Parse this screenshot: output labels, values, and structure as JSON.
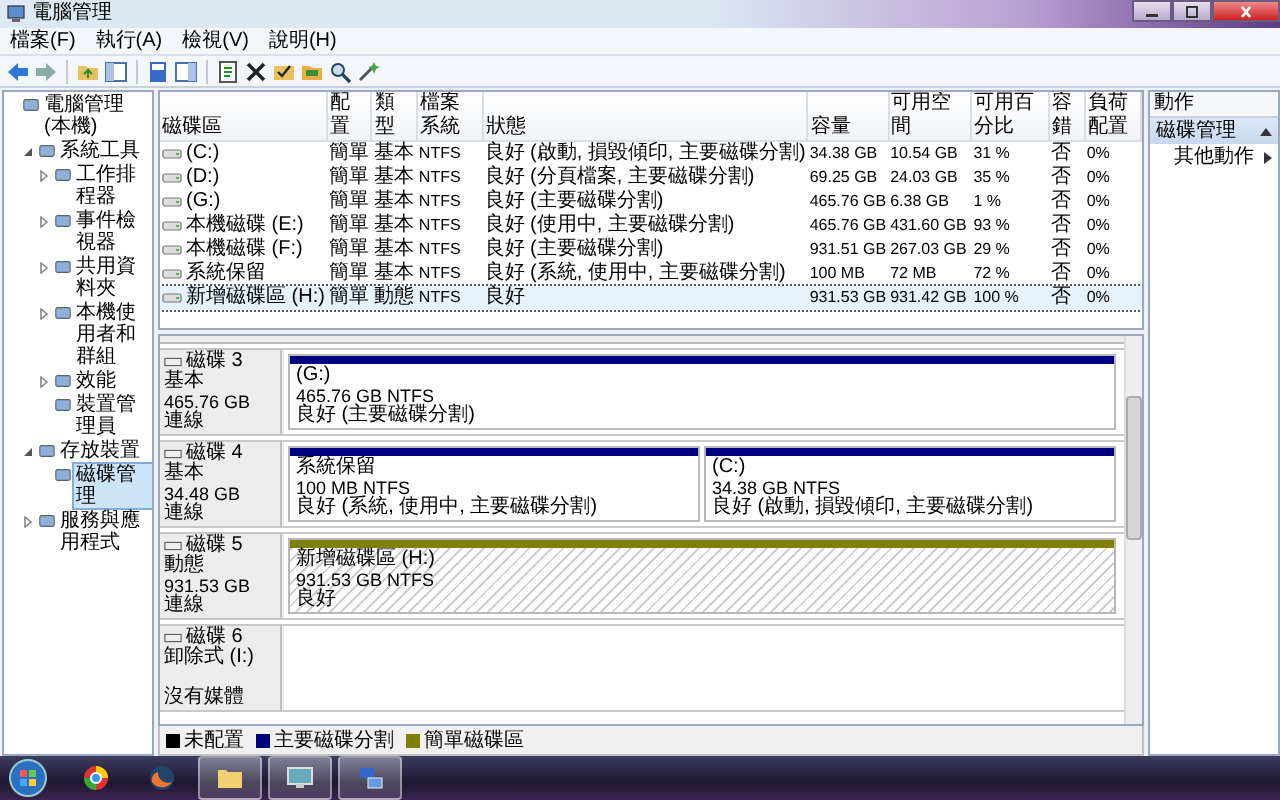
{
  "window": {
    "title": "電腦管理"
  },
  "menu": [
    "檔案(F)",
    "執行(A)",
    "檢視(V)",
    "說明(H)"
  ],
  "tree": [
    {
      "label": "電腦管理 (本機)",
      "selected": false,
      "children": [
        {
          "label": "系統工具",
          "expanded": true,
          "selected": false,
          "children": [
            {
              "label": "工作排程器",
              "expanded": false,
              "selected": false
            },
            {
              "label": "事件檢視器",
              "expanded": false,
              "selected": false
            },
            {
              "label": "共用資料夾",
              "expanded": false,
              "selected": false
            },
            {
              "label": "本機使用者和群組",
              "expanded": false,
              "selected": false
            },
            {
              "label": "效能",
              "expanded": false,
              "selected": false
            },
            {
              "label": "裝置管理員",
              "selected": false
            }
          ]
        },
        {
          "label": "存放裝置",
          "expanded": true,
          "selected": false,
          "children": [
            {
              "label": "磁碟管理",
              "selected": true
            }
          ]
        },
        {
          "label": "服務與應用程式",
          "expanded": false,
          "selected": false
        }
      ]
    }
  ],
  "table": {
    "columns": [
      "磁碟區",
      "配置",
      "類型",
      "檔案系統",
      "狀態",
      "容量",
      "可用空間",
      "可用百分比",
      "容錯",
      "負荷配置"
    ],
    "rows": [
      {
        "selected": false,
        "cells": [
          "(C:)",
          "簡單",
          "基本",
          "NTFS",
          "良好 (啟動, 損毀傾印, 主要磁碟分割)",
          "34.38 GB",
          "10.54 GB",
          "31 %",
          "否",
          "0%"
        ]
      },
      {
        "selected": false,
        "cells": [
          "(D:)",
          "簡單",
          "基本",
          "NTFS",
          "良好 (分頁檔案, 主要磁碟分割)",
          "69.25 GB",
          "24.03 GB",
          "35 %",
          "否",
          "0%"
        ]
      },
      {
        "selected": false,
        "cells": [
          "(G:)",
          "簡單",
          "基本",
          "NTFS",
          "良好 (主要磁碟分割)",
          "465.76 GB",
          "6.38 GB",
          "1 %",
          "否",
          "0%"
        ]
      },
      {
        "selected": false,
        "cells": [
          "本機磁碟 (E:)",
          "簡單",
          "基本",
          "NTFS",
          "良好 (使用中, 主要磁碟分割)",
          "465.76 GB",
          "431.60 GB",
          "93 %",
          "否",
          "0%"
        ]
      },
      {
        "selected": false,
        "cells": [
          "本機磁碟 (F:)",
          "簡單",
          "基本",
          "NTFS",
          "良好 (主要磁碟分割)",
          "931.51 GB",
          "267.03 GB",
          "29 %",
          "否",
          "0%"
        ]
      },
      {
        "selected": false,
        "cells": [
          "系統保留",
          "簡單",
          "基本",
          "NTFS",
          "良好 (系統, 使用中, 主要磁碟分割)",
          "100 MB",
          "72 MB",
          "72 %",
          "否",
          "0%"
        ]
      },
      {
        "selected": true,
        "cells": [
          "新增磁碟區 (H:)",
          "簡單",
          "動態",
          "NTFS",
          "良好",
          "931.53 GB",
          "931.42 GB",
          "100 %",
          "否",
          "0%"
        ]
      }
    ]
  },
  "disks": [
    {
      "name": "磁碟 3",
      "type": "基本",
      "size": "465.76 GB",
      "status": "連線",
      "partitions": [
        {
          "label": "(G:)",
          "size": "465.76 GB NTFS",
          "status": "良好 (主要磁碟分割)",
          "color": "#00007f",
          "selected": false
        }
      ]
    },
    {
      "name": "磁碟 4",
      "type": "基本",
      "size": "34.48 GB",
      "status": "連線",
      "partitions": [
        {
          "label": "系統保留",
          "size": "100 MB NTFS",
          "status": "良好 (系統, 使用中, 主要磁碟分割)",
          "color": "#00007f",
          "selected": false
        },
        {
          "label": "(C:)",
          "size": "34.38 GB NTFS",
          "status": "良好 (啟動, 損毀傾印, 主要磁碟分割)",
          "color": "#00007f",
          "selected": false
        }
      ]
    },
    {
      "name": "磁碟 5",
      "type": "動態",
      "size": "931.53 GB",
      "status": "連線",
      "partitions": [
        {
          "label": "新增磁碟區 (H:)",
          "size": "931.53 GB NTFS",
          "status": "良好",
          "color": "#808000",
          "selected": true
        }
      ]
    },
    {
      "name": "磁碟 6",
      "type": "卸除式 (I:)",
      "status": "沒有媒體"
    }
  ],
  "legend": [
    {
      "label": "未配置",
      "color": "#000000"
    },
    {
      "label": "主要磁碟分割",
      "color": "#00007f"
    },
    {
      "label": "簡單磁碟區",
      "color": "#808000"
    }
  ],
  "actions": {
    "title": "動作",
    "groups": [
      {
        "label": "磁碟管理",
        "expanded": true,
        "items": [
          "其他動作"
        ]
      }
    ]
  }
}
